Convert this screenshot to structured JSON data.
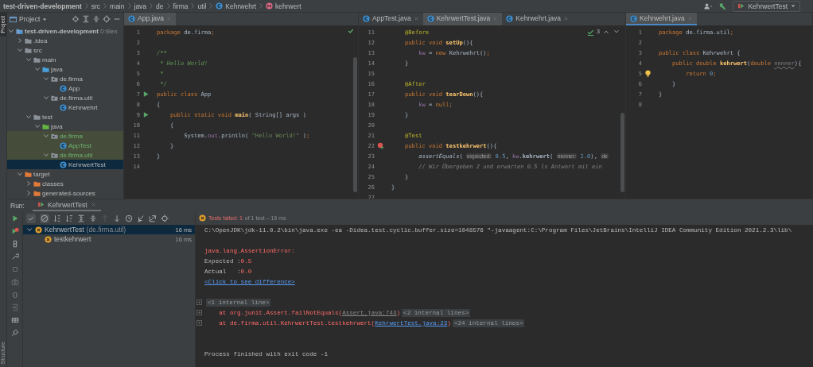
{
  "breadcrumb": [
    {
      "label": "test-driven-development",
      "kind": "project"
    },
    {
      "label": "src",
      "kind": "text"
    },
    {
      "label": "main",
      "kind": "text"
    },
    {
      "label": "java",
      "kind": "text"
    },
    {
      "label": "de",
      "kind": "text"
    },
    {
      "label": "firma",
      "kind": "text"
    },
    {
      "label": "util",
      "kind": "text"
    },
    {
      "label": "Kehrwehrt",
      "kind": "class"
    },
    {
      "label": "kehrwert",
      "kind": "method"
    }
  ],
  "run_configuration": "KehrwertTest",
  "side_tabs": [
    {
      "label": "Project",
      "selected": true
    },
    {
      "label": "Structure",
      "selected": false
    }
  ],
  "project_panel": {
    "title": "Project",
    "tree": [
      {
        "label": "test-driven-development",
        "path": "D:\\Ben",
        "kind": "module",
        "expanded": true,
        "selected": false,
        "children": [
          {
            "label": ".idea",
            "kind": "folder",
            "expanded": false,
            "selected": false
          },
          {
            "label": "src",
            "kind": "folder",
            "expanded": true,
            "selected": false,
            "children": [
              {
                "label": "main",
                "kind": "folder",
                "expanded": true,
                "selected": false,
                "children": [
                  {
                    "label": "java",
                    "kind": "source-root",
                    "expanded": true,
                    "selected": false,
                    "children": [
                      {
                        "label": "de.firma",
                        "kind": "package",
                        "expanded": true,
                        "selected": false,
                        "children": [
                          {
                            "label": "App",
                            "kind": "class",
                            "selected": false
                          }
                        ]
                      },
                      {
                        "label": "de.firma.util",
                        "kind": "package",
                        "expanded": true,
                        "selected": false,
                        "children": [
                          {
                            "label": "Kehrwehrt",
                            "kind": "class",
                            "selected": false
                          }
                        ]
                      }
                    ]
                  }
                ]
              },
              {
                "label": "test",
                "kind": "folder",
                "expanded": true,
                "selected": false,
                "children": [
                  {
                    "label": "java",
                    "kind": "test-root",
                    "expanded": true,
                    "selected": false,
                    "children": [
                      {
                        "label": "de.firma",
                        "kind": "package",
                        "expanded": true,
                        "selected": false,
                        "children": [
                          {
                            "label": "AppTest",
                            "kind": "class",
                            "selected": false
                          }
                        ]
                      },
                      {
                        "label": "de.firma.util",
                        "kind": "package",
                        "expanded": true,
                        "selected": false,
                        "children": [
                          {
                            "label": "KehrwertTest",
                            "kind": "class",
                            "selected": true
                          }
                        ]
                      }
                    ]
                  }
                ]
              }
            ]
          },
          {
            "label": "target",
            "kind": "excluded",
            "expanded": true,
            "selected": false,
            "children": [
              {
                "label": "classes",
                "kind": "excluded",
                "expanded": false,
                "selected": false
              },
              {
                "label": "generated-sources",
                "kind": "excluded",
                "expanded": false,
                "selected": false
              }
            ]
          }
        ]
      }
    ]
  },
  "editors": [
    {
      "tabs": [
        {
          "label": "App.java",
          "selected": true
        }
      ],
      "checks_passed": true,
      "lines": [
        {
          "number": "1",
          "tokens": [
            {
              "kind": "keyword",
              "text": "package "
            },
            {
              "kind": "plain",
              "text": "de.firma"
            },
            {
              "kind": "keyword",
              "text": ";"
            }
          ]
        },
        {
          "number": "2"
        },
        {
          "number": "3",
          "tokens": [
            {
              "kind": "doc",
              "text": "/**"
            }
          ]
        },
        {
          "number": "4",
          "tokens": [
            {
              "kind": "doc",
              "text": " * Hello World!"
            }
          ]
        },
        {
          "number": "5",
          "tokens": [
            {
              "kind": "doc",
              "text": " *"
            }
          ]
        },
        {
          "number": "6",
          "tokens": [
            {
              "kind": "doc",
              "text": " */"
            }
          ]
        },
        {
          "number": "7",
          "kind": "run",
          "tokens": [
            {
              "kind": "keyword",
              "text": "public class "
            },
            {
              "kind": "plain",
              "text": "App"
            }
          ]
        },
        {
          "number": "8",
          "tokens": [
            {
              "kind": "plain",
              "text": "{"
            }
          ]
        },
        {
          "number": "9",
          "kind": "run",
          "tokens": [
            {
              "kind": "keyword",
              "text": "    public static void "
            },
            {
              "kind": "method",
              "text": "main"
            },
            {
              "kind": "plain",
              "text": "( String[] args )"
            }
          ]
        },
        {
          "number": "10",
          "tokens": [
            {
              "kind": "plain",
              "text": "    {"
            }
          ]
        },
        {
          "number": "11",
          "tokens": [
            {
              "kind": "plain",
              "text": "        System."
            },
            {
              "kind": "field",
              "text": "out"
            },
            {
              "kind": "plain",
              "text": ".println( "
            },
            {
              "kind": "string",
              "text": "\"Hello World!\""
            },
            {
              "kind": "plain",
              "text": " )"
            },
            {
              "kind": "keyword",
              "text": ";"
            }
          ]
        },
        {
          "number": "12",
          "tokens": [
            {
              "kind": "plain",
              "text": "    }"
            }
          ]
        },
        {
          "number": "13",
          "tokens": [
            {
              "kind": "plain",
              "text": "}"
            }
          ]
        },
        {
          "number": "14"
        }
      ]
    },
    {
      "tabs": [
        {
          "label": "AppTest.java",
          "selected": false
        },
        {
          "label": "KehrwertTest.java",
          "selected": true
        },
        {
          "label": "Kehrwehrt.java",
          "selected": false
        }
      ],
      "inspections": "3",
      "lines": [
        {
          "number": "11",
          "tokens": [
            {
              "kind": "annotation",
              "text": "    @Before"
            }
          ]
        },
        {
          "number": "12",
          "tokens": [
            {
              "kind": "keyword",
              "text": "    public void "
            },
            {
              "kind": "method",
              "text": "setUp"
            },
            {
              "kind": "plain",
              "text": "(){"
            }
          ]
        },
        {
          "number": "13",
          "tokens": [
            {
              "kind": "field",
              "text": "        kw"
            },
            {
              "kind": "plain",
              "text": " = "
            },
            {
              "kind": "keyword",
              "text": "new "
            },
            {
              "kind": "plain",
              "text": "Kehrwehrt()"
            },
            {
              "kind": "keyword",
              "text": ";"
            }
          ]
        },
        {
          "number": "14",
          "tokens": [
            {
              "kind": "plain",
              "text": "    }"
            }
          ]
        },
        {
          "number": "15"
        },
        {
          "number": "16",
          "tokens": [
            {
              "kind": "annotation",
              "text": "    @After"
            }
          ]
        },
        {
          "number": "17",
          "tokens": [
            {
              "kind": "keyword",
              "text": "    public void "
            },
            {
              "kind": "method",
              "text": "tearDown"
            },
            {
              "kind": "plain",
              "text": "(){"
            }
          ]
        },
        {
          "number": "18",
          "tokens": [
            {
              "kind": "field",
              "text": "        kw"
            },
            {
              "kind": "plain",
              "text": " = "
            },
            {
              "kind": "keyword",
              "text": "null;"
            }
          ]
        },
        {
          "number": "19",
          "tokens": [
            {
              "kind": "plain",
              "text": "    }"
            }
          ]
        },
        {
          "number": "20"
        },
        {
          "number": "21",
          "tokens": [
            {
              "kind": "annotation",
              "text": "    @Test"
            }
          ]
        },
        {
          "number": "22",
          "kind": "run-failed",
          "tokens": [
            {
              "kind": "keyword",
              "text": "    public void "
            },
            {
              "kind": "method",
              "text": "testkehrwert"
            },
            {
              "kind": "plain",
              "text": "(){"
            }
          ]
        },
        {
          "number": "23",
          "tokens": [
            {
              "kind": "italic",
              "text": "        assertEquals"
            },
            {
              "kind": "plain",
              "text": "( "
            },
            {
              "kind": "hint",
              "text": "expected:"
            },
            {
              "kind": "number",
              "text": " 0.5"
            },
            {
              "kind": "plain",
              "text": ", "
            },
            {
              "kind": "field",
              "text": "kw"
            },
            {
              "kind": "plain",
              "text": "."
            },
            {
              "kind": "bold",
              "text": "kehrwert"
            },
            {
              "kind": "plain",
              "text": "( "
            },
            {
              "kind": "hint",
              "text": "nenner:"
            },
            {
              "kind": "number",
              "text": " 2.0"
            },
            {
              "kind": "plain",
              "text": "), "
            },
            {
              "kind": "hint",
              "text": "de"
            }
          ]
        },
        {
          "number": "24",
          "tokens": [
            {
              "kind": "comment",
              "text": "        // Wir Übergeben 2 und erwarten 0.5 ls Antwort mit ein"
            }
          ]
        },
        {
          "number": "25",
          "tokens": [
            {
              "kind": "plain",
              "text": "    }"
            }
          ]
        },
        {
          "number": "26",
          "tokens": [
            {
              "kind": "plain",
              "text": "}"
            }
          ]
        },
        {
          "number": "27"
        }
      ]
    },
    {
      "tabs": [
        {
          "label": "Kehrwehrt.java",
          "selected": true
        }
      ],
      "lines": [
        {
          "number": "1",
          "tokens": [
            {
              "kind": "keyword",
              "text": "package "
            },
            {
              "kind": "plain",
              "text": "de.firma.util"
            },
            {
              "kind": "keyword",
              "text": ";"
            }
          ]
        },
        {
          "number": "2"
        },
        {
          "number": "3",
          "tokens": [
            {
              "kind": "keyword",
              "text": "public class "
            },
            {
              "kind": "plain",
              "text": "Kehrwehrt {"
            }
          ]
        },
        {
          "number": "4",
          "tokens": [
            {
              "kind": "keyword",
              "text": "    public double "
            },
            {
              "kind": "method",
              "text": "kehrwert"
            },
            {
              "kind": "plain",
              "text": "("
            },
            {
              "kind": "keyword",
              "text": "double "
            },
            {
              "kind": "param",
              "text": "nenner"
            },
            {
              "kind": "plain",
              "text": "){"
            }
          ]
        },
        {
          "number": "5",
          "kind": "bulb",
          "tokens": [
            {
              "kind": "keyword",
              "text": "        return "
            },
            {
              "kind": "number",
              "text": "0"
            },
            {
              "kind": "keyword",
              "text": ";"
            }
          ]
        },
        {
          "number": "6",
          "tokens": [
            {
              "kind": "plain",
              "text": "    }"
            }
          ]
        },
        {
          "number": "7",
          "tokens": [
            {
              "kind": "plain",
              "text": "}"
            }
          ]
        },
        {
          "number": "8"
        }
      ]
    }
  ],
  "run_panel": {
    "label": "Run:",
    "tabs": [
      {
        "label": "KehrwertTest",
        "selected": true
      }
    ],
    "tests": [
      {
        "label": "KehrwertTest",
        "detail": "(de.firma.util)",
        "time": "16 ms",
        "failed": true,
        "selected": true,
        "expanded": true,
        "children": [
          {
            "label": "testkehrwert",
            "time": "16 ms",
            "failed": true,
            "selected": false
          }
        ]
      }
    ],
    "summary": {
      "failed": true,
      "label": "Tests failed: 1",
      "detail": "of 1 test – 16 ms"
    },
    "console": [
      {
        "kind": "command",
        "lines": [
          {
            "tokens": [
              {
                "kind": "plain",
                "text": "C:\\OpenJDK\\jdk-11.0.2\\bin\\java.exe -ea -Didea.test.cyclic.buffer.size=1048576 \"-javaagent:C:\\Program Files\\JetBrains\\IntelliJ IDEA Community Edition 2021.2.3\\lib\\"
              }
            ]
          }
        ]
      },
      {
        "kind": "output",
        "lines": [
          {
            "tokens": [
              {
                "kind": "error",
                "text": "java.lang.AssertionError: "
              }
            ]
          },
          {
            "tokens": [
              {
                "kind": "plain",
                "text": "Expected :"
              },
              {
                "kind": "error",
                "text": "0.5"
              }
            ]
          },
          {
            "tokens": [
              {
                "kind": "plain",
                "text": "Actual   :"
              },
              {
                "kind": "error",
                "text": "0.0"
              }
            ]
          },
          {
            "tokens": [
              {
                "kind": "link",
                "text": "<Click to see difference>"
              }
            ]
          }
        ]
      },
      {
        "kind": "trace",
        "lines": [
          {
            "foldable": true,
            "tokens": [
              {
                "kind": "folded",
                "text": "<1 internal line>"
              }
            ]
          },
          {
            "foldable": true,
            "tokens": [
              {
                "kind": "error",
                "text": "    at org.junit.Assert.failNotEquals("
              },
              {
                "kind": "source-link",
                "text": "Assert.java:743"
              },
              {
                "kind": "error",
                "text": ")"
              },
              {
                "kind": "folded",
                "text": "<2 internal lines>"
              }
            ]
          },
          {
            "foldable": true,
            "tokens": [
              {
                "kind": "error",
                "text": "    at de.firma.util.KehrwertTest.testkehrwert("
              },
              {
                "kind": "link",
                "text": "KehrwertTest.java:23"
              },
              {
                "kind": "error",
                "text": ")"
              },
              {
                "kind": "folded",
                "text": "<24 internal lines>"
              }
            ]
          }
        ]
      },
      {
        "kind": "exit",
        "lines": [
          {
            "tokens": [
              {
                "kind": "plain",
                "text": "Process finished with exit code -1"
              }
            ]
          }
        ]
      }
    ]
  }
}
